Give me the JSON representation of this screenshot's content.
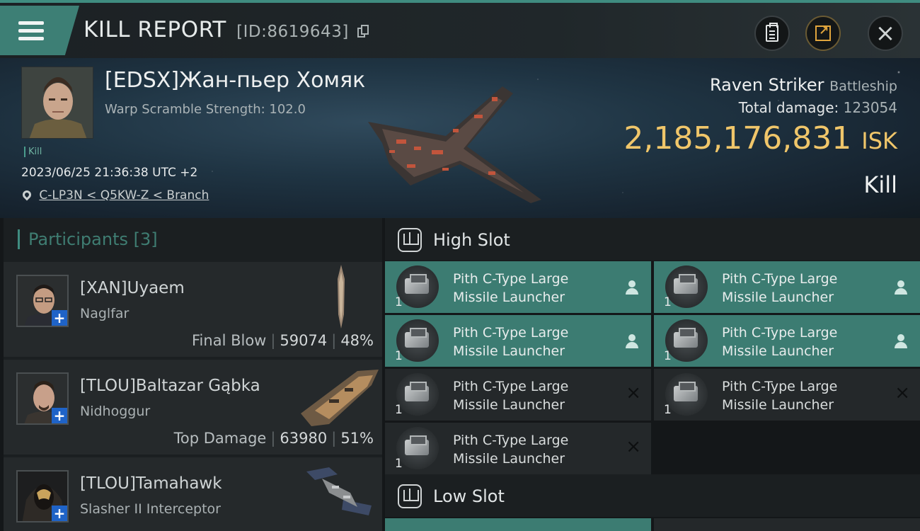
{
  "header": {
    "title": "KILL REPORT",
    "kill_id": "[ID:8619643]"
  },
  "victim": {
    "name": "[EDSX]Жан-пьер Хомяк",
    "scramble_label": "Warp Scramble Strength:",
    "scramble_value": "102.0",
    "tag": "Kill",
    "time": "2023/06/25 21:36:38 UTC +2",
    "location": "C-LP3N < Q5KW-Z < Branch",
    "ship_name": "Raven Striker",
    "ship_class": "Battleship",
    "damage_label": "Total damage:",
    "damage_value": "123054",
    "isk_value": "2,185,176,831",
    "isk_unit": "ISK",
    "result": "Kill"
  },
  "participants": {
    "title": "Participants [3]",
    "items": [
      {
        "name": "[XAN]Uyaem",
        "ship": "Naglfar",
        "stat_label": "Final Blow",
        "damage": "59074",
        "percent": "48%"
      },
      {
        "name": "[TLOU]Baltazar Gąbka",
        "ship": "Nidhoggur",
        "stat_label": "Top Damage",
        "damage": "63980",
        "percent": "51%"
      },
      {
        "name": "[TLOU]Tamahawk",
        "ship": "Slasher II Interceptor",
        "stat_label": "",
        "damage": "",
        "percent": ""
      }
    ]
  },
  "slots": {
    "high": {
      "label": "High Slot",
      "modules": [
        {
          "name_line1": "Pith C-Type Large",
          "name_line2": "Missile Launcher",
          "qty": "1",
          "status": "dropped"
        },
        {
          "name_line1": "Pith C-Type Large",
          "name_line2": "Missile Launcher",
          "qty": "1",
          "status": "dropped"
        },
        {
          "name_line1": "Pith C-Type Large",
          "name_line2": "Missile Launcher",
          "qty": "1",
          "status": "dropped"
        },
        {
          "name_line1": "Pith C-Type Large",
          "name_line2": "Missile Launcher",
          "qty": "1",
          "status": "dropped"
        },
        {
          "name_line1": "Pith C-Type Large",
          "name_line2": "Missile Launcher",
          "qty": "1",
          "status": "destroyed"
        },
        {
          "name_line1": "Pith C-Type Large",
          "name_line2": "Missile Launcher",
          "qty": "1",
          "status": "destroyed"
        },
        {
          "name_line1": "Pith C-Type Large",
          "name_line2": "Missile Launcher",
          "qty": "1",
          "status": "destroyed"
        }
      ]
    },
    "low": {
      "label": "Low Slot"
    }
  },
  "icons": {
    "menu": "hamburger-menu-icon",
    "report": "clipboard-icon",
    "share": "share-icon",
    "close": "close-icon",
    "location": "map-pin-icon",
    "dropped": "pilot-icon",
    "destroyed": "destroyed-x-icon"
  },
  "colors": {
    "accent": "#3f8c80",
    "dropped_bg": "#3c7c72",
    "isk": "#f0c66a",
    "badge": "#1f63c7"
  }
}
